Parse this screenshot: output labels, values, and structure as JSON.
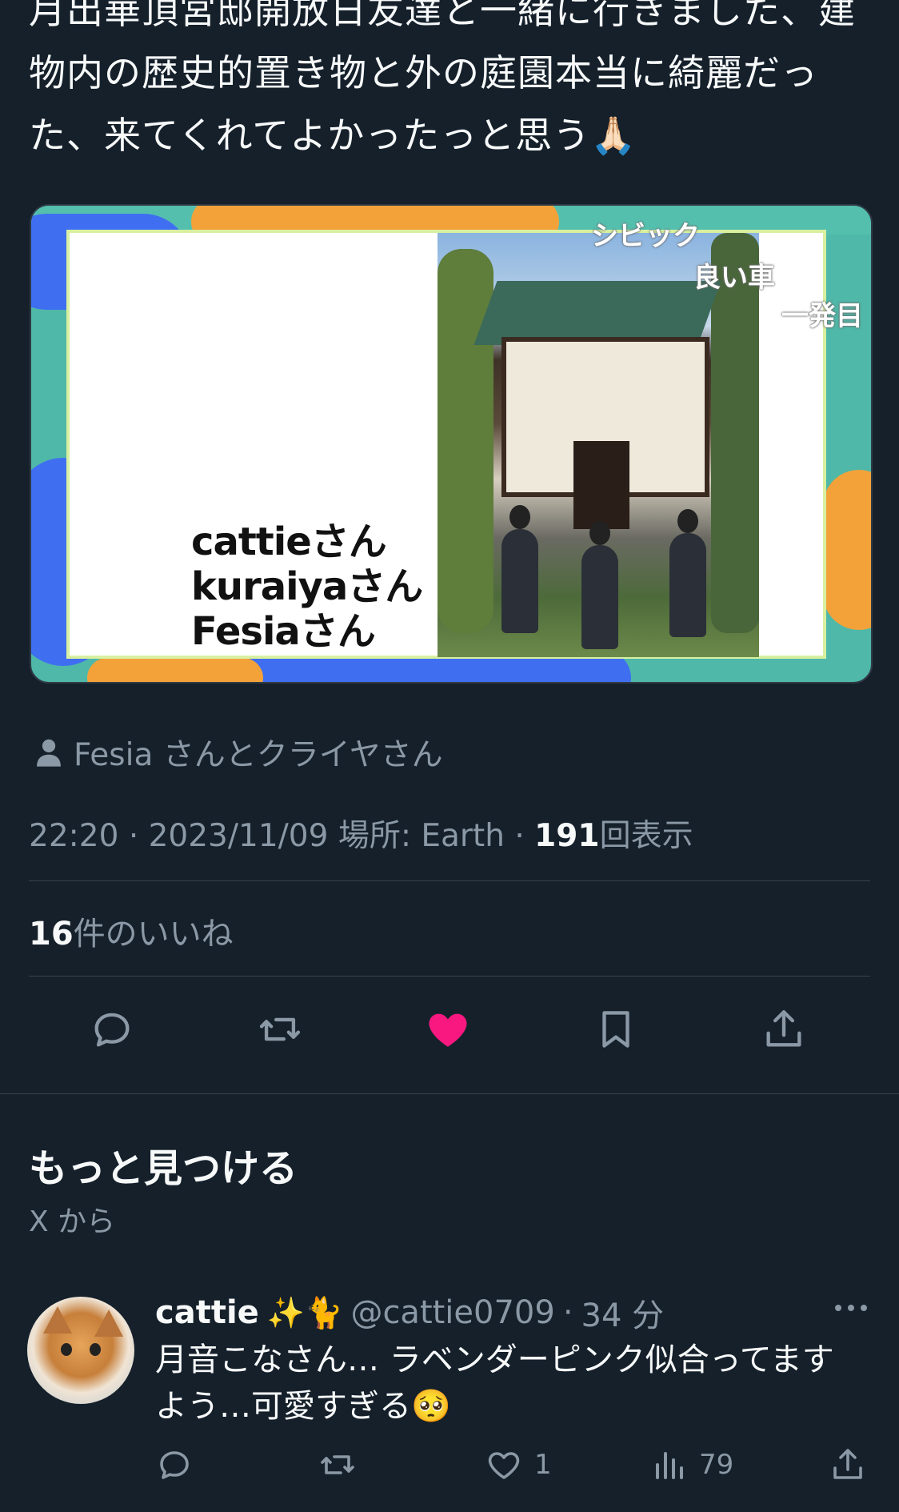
{
  "tweet": {
    "text_lines": [
      "月出華頂宮邸開放日友達と一緒に行きました、建",
      "物内の歴史的置き物と外の庭園本当に綺麗だっ",
      "た、来てくれてよかったっと思う🙏🏻"
    ],
    "media": {
      "caption_names": [
        "cattieさん",
        "kuraiyaさん",
        "Fesiaさん"
      ],
      "overlay_comments": [
        "シビック",
        "良い車",
        "一発目"
      ]
    },
    "tagged_people": "Fesia さんとクライヤさん",
    "time": "22:20",
    "date": "2023/11/09",
    "location_label": "場所: Earth",
    "views_count": "191",
    "views_label": "回表示",
    "likes_count": "16",
    "likes_label": "件のいいね"
  },
  "actions": {
    "reply_icon": "reply-icon",
    "retweet_icon": "retweet-icon",
    "like_icon": "heart-filled-icon",
    "bookmark_icon": "bookmark-icon",
    "share_icon": "share-icon"
  },
  "discover": {
    "title": "もっと見つける",
    "subtitle": "X から"
  },
  "reply": {
    "name": "cattie",
    "emojis": "✨🐈",
    "handle": "@cattie0709",
    "separator": "·",
    "time": "34 分",
    "body_lines": [
      "月音こなさん… ラベンダーピンク似合ってます",
      "よう…可愛すぎる🥺"
    ],
    "likes": "1",
    "views": "79"
  },
  "colors": {
    "background": "#15202b",
    "text": "#f7f9f9",
    "muted": "#8b98a5",
    "like_pink": "#f91880",
    "divider": "#38444d"
  }
}
